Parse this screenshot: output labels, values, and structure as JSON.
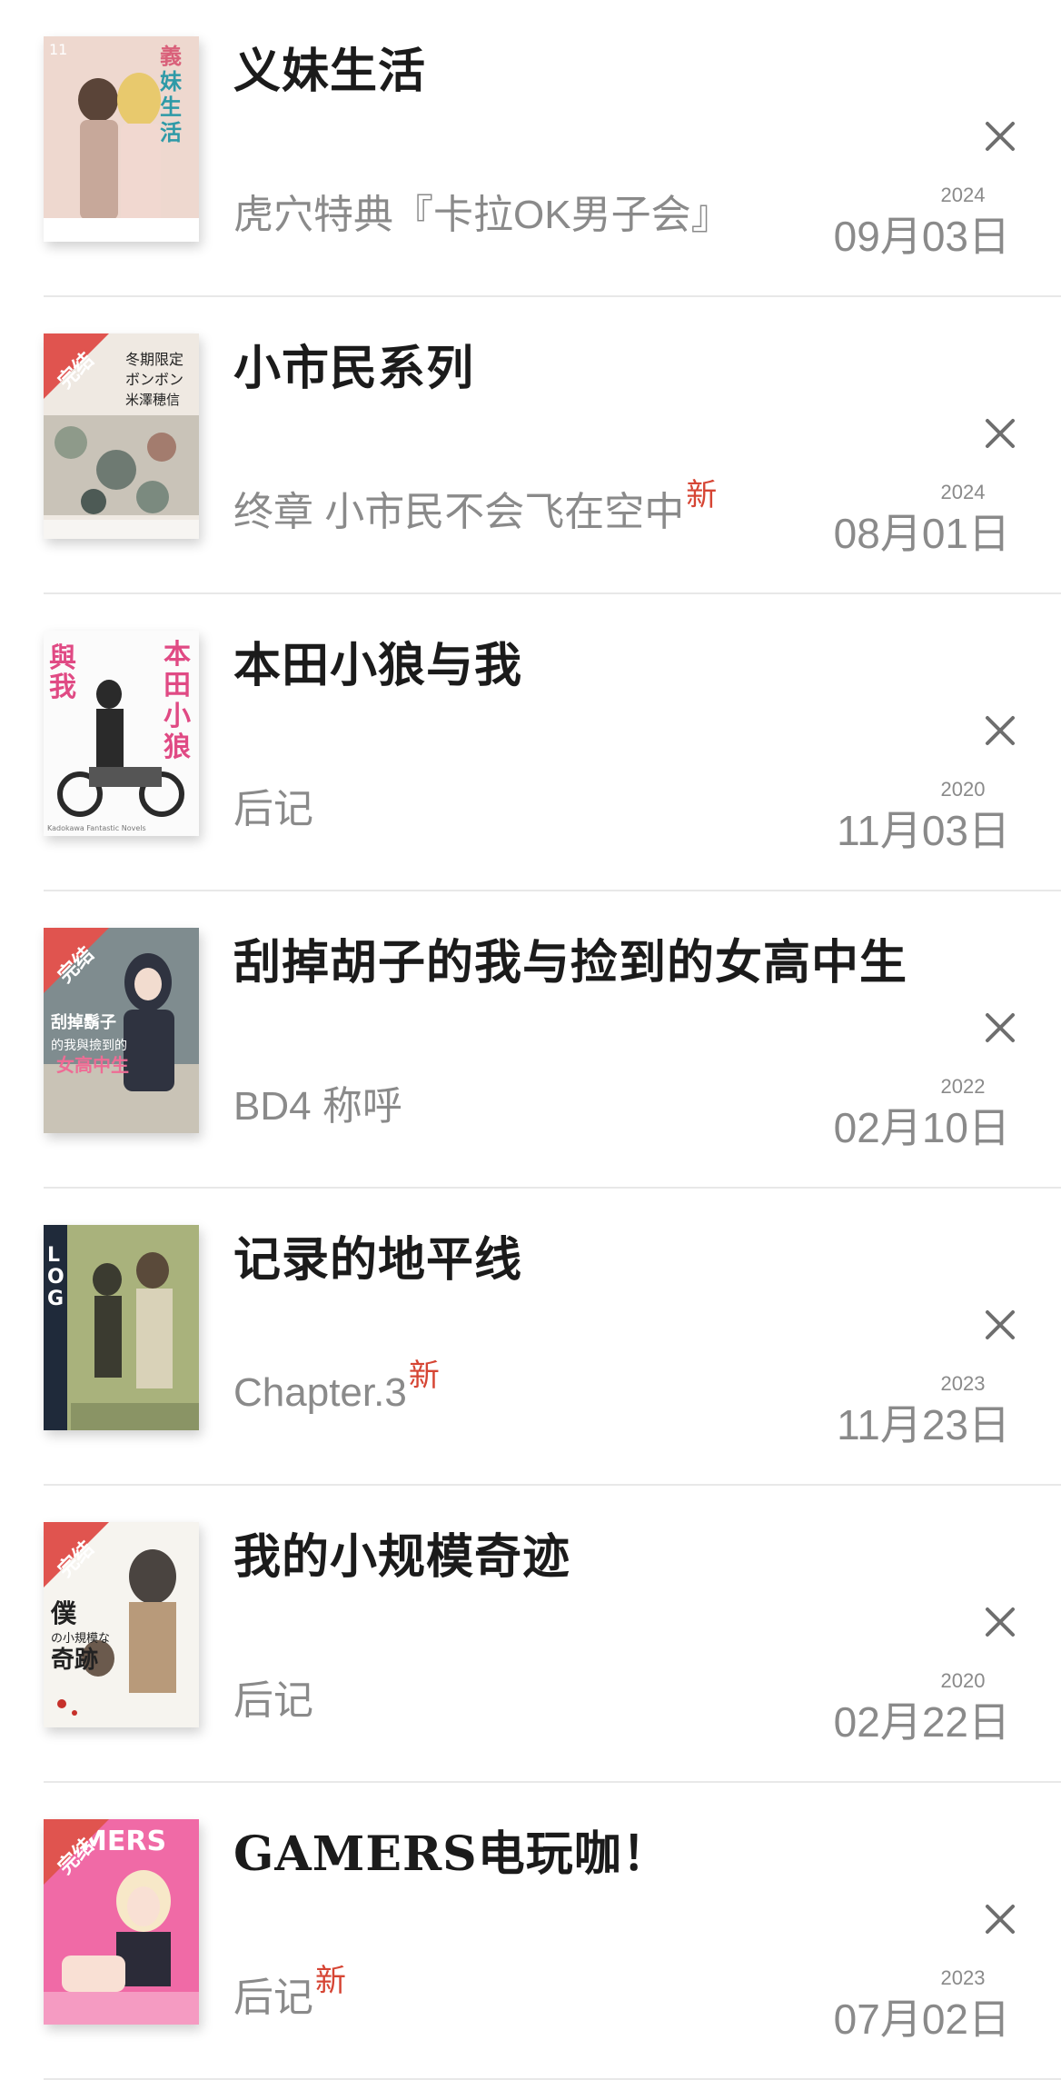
{
  "new_badge": "新",
  "completed_ribbon": "完结",
  "items": [
    {
      "title": "义妹生活",
      "chapter": "虎穴特典『卡拉OK男子会』",
      "is_new": false,
      "year": "2024",
      "date": "09月03日",
      "completed": false,
      "cover_theme": [
        "#f3e4dd",
        "#d8b7a8",
        "#e8c96d"
      ]
    },
    {
      "title": "小市民系列",
      "chapter": "终章 小市民不会飞在空中",
      "is_new": true,
      "year": "2024",
      "date": "08月01日",
      "completed": true,
      "cover_theme": [
        "#efe9e2",
        "#8e9a8a",
        "#c7c1b8"
      ]
    },
    {
      "title": "本田小狼与我",
      "chapter": "后记",
      "is_new": false,
      "year": "2020",
      "date": "11月03日",
      "completed": false,
      "cover_theme": [
        "#fbfbfb",
        "#2a2a2a",
        "#e04a84"
      ]
    },
    {
      "title": "刮掉胡子的我与捡到的女高中生",
      "chapter": "BD4 称呼",
      "is_new": false,
      "year": "2022",
      "date": "02月10日",
      "completed": true,
      "cover_theme": [
        "#7f8c8f",
        "#2f3340",
        "#c9c3b6"
      ]
    },
    {
      "title": "记录的地平线",
      "chapter": "Chapter.3",
      "is_new": true,
      "year": "2023",
      "date": "11月23日",
      "completed": false,
      "cover_theme": [
        "#a9b27c",
        "#3b3b30",
        "#d9d2b8"
      ]
    },
    {
      "title": "我的小规模奇迹",
      "chapter": "后记",
      "is_new": false,
      "year": "2020",
      "date": "02月22日",
      "completed": true,
      "cover_theme": [
        "#f6f4ef",
        "#4a4440",
        "#b89a7a"
      ]
    },
    {
      "title": "GAMERS电玩咖！",
      "chapter": "后记",
      "is_new": true,
      "year": "2023",
      "date": "07月02日",
      "completed": true,
      "cover_theme": [
        "#f06aa6",
        "#f7e8c8",
        "#2b2b38"
      ]
    }
  ]
}
